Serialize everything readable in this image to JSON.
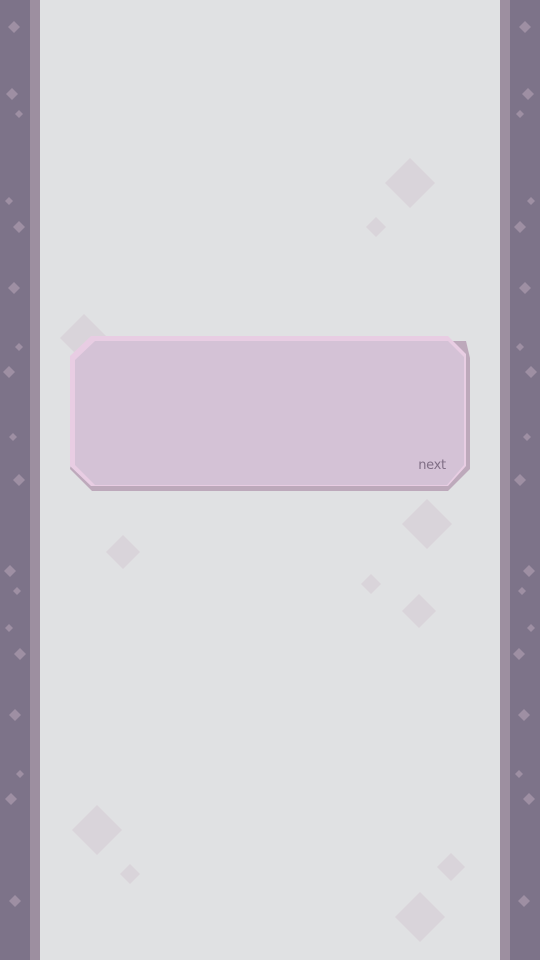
{
  "dialog": {
    "text": "",
    "next_label": "next"
  },
  "colors": {
    "background": "#e0e1e3",
    "side_dark": "#7d7389",
    "side_light": "#9d8fa0",
    "dialog_fill": "#d4c2d6",
    "dialog_highlight": "#e8cde3",
    "dialog_shadow": "#bda9bb",
    "next_text": "#806f86"
  }
}
